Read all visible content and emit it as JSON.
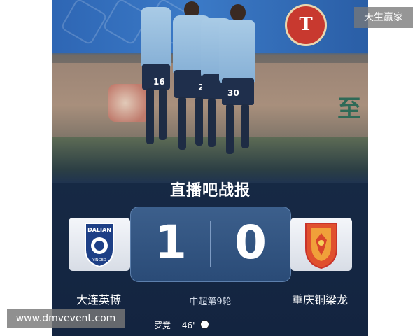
{
  "watermarks": {
    "top_right": "天生赢家",
    "bottom_left": "www.dmvevent.com"
  },
  "photo": {
    "club_badge_letter": "T",
    "player_numbers": [
      "16",
      "2",
      "30"
    ]
  },
  "report": {
    "title": "直播吧战报",
    "home_team": "大连英博",
    "away_team": "重庆铜梁龙",
    "home_score": "1",
    "away_score": "0",
    "competition_round": "中超第9轮",
    "scorer_name": "罗竞",
    "scorer_minute": "46'",
    "home_logo_text": "DALIAN",
    "home_logo_sub": "YINGBO"
  },
  "colors": {
    "card_bg": "#1a2d4a",
    "score_box": "#34577f",
    "away_logo": "#e0502e"
  }
}
